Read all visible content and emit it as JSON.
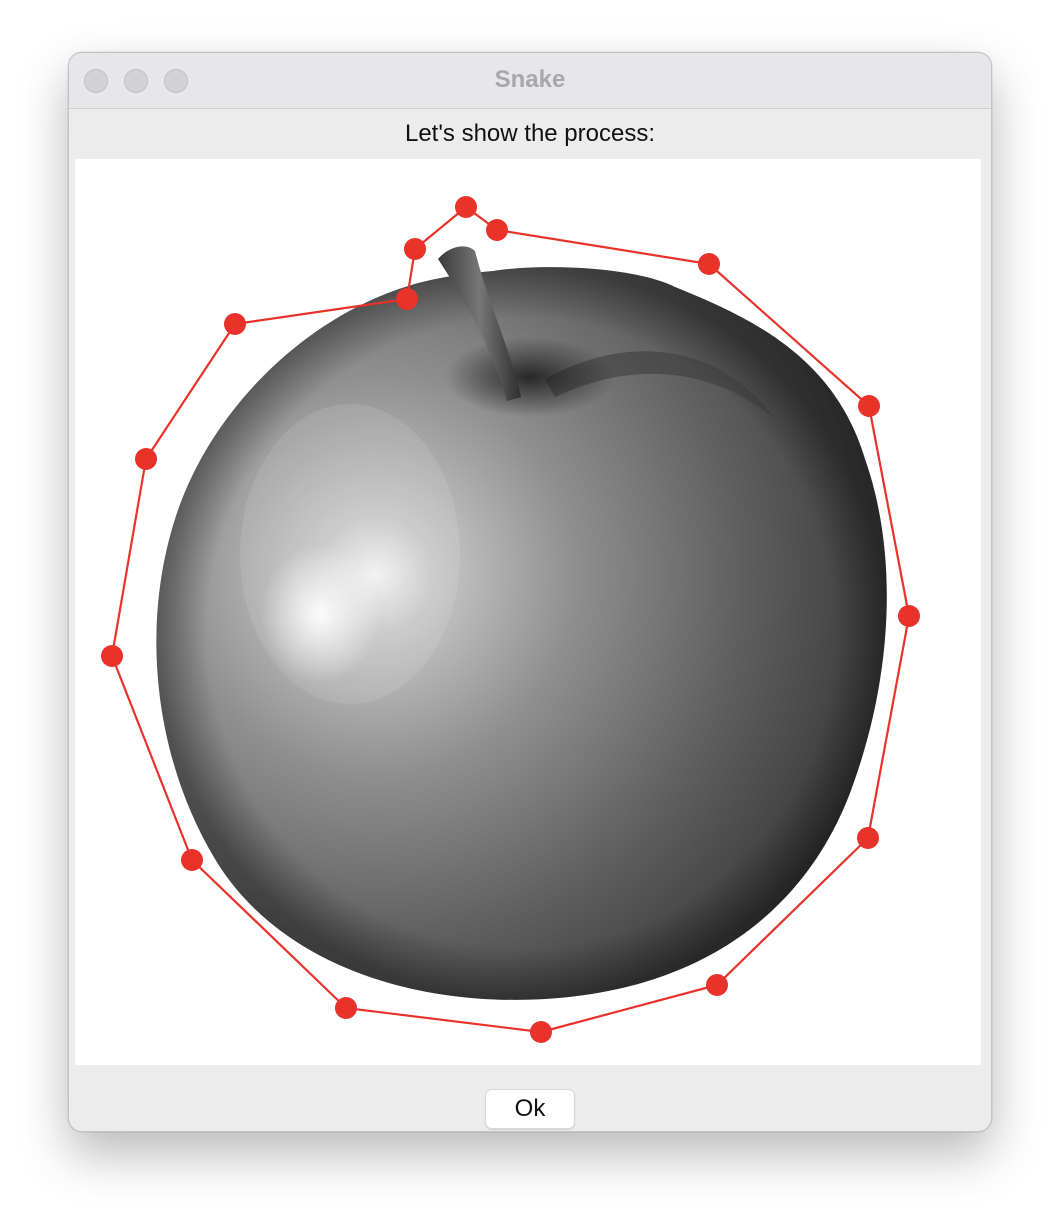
{
  "window": {
    "title": "Snake"
  },
  "message": "Let's show the process:",
  "buttons": {
    "ok_label": "Ok"
  },
  "image": {
    "subject": "apple",
    "rendering": "grayscale"
  },
  "contour": {
    "color": "#e8322a",
    "closed": true
  },
  "colors": {
    "window_background": "#ececec",
    "title_text": "#a8a7ab",
    "traffic_light": "#d3d2d5",
    "contour": "#e8322a"
  }
}
